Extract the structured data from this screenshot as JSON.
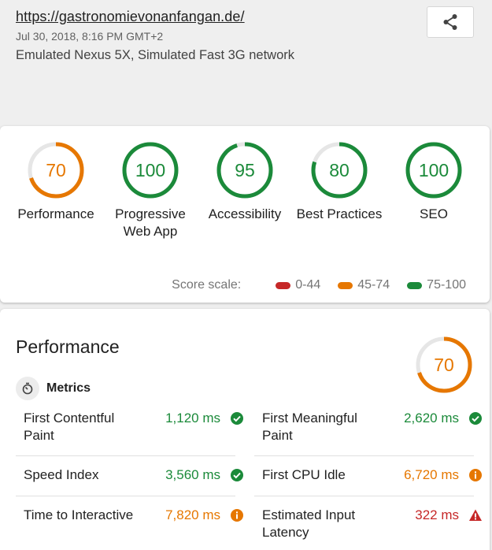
{
  "report": {
    "url": "https://gastronomievonanfangan.de/",
    "date": "Jul 30, 2018, 8:16 PM GMT+2",
    "device": "Emulated Nexus 5X, Simulated Fast 3G network"
  },
  "colors": {
    "fail": "#c62828",
    "average": "#e67700",
    "pass": "#1b8a3a"
  },
  "categories": [
    {
      "score": "70",
      "label": "Performance",
      "rating": "average"
    },
    {
      "score": "100",
      "label": "Progressive Web App",
      "rating": "pass"
    },
    {
      "score": "95",
      "label": "Accessibility",
      "rating": "pass"
    },
    {
      "score": "80",
      "label": "Best Practices",
      "rating": "pass"
    },
    {
      "score": "100",
      "label": "SEO",
      "rating": "pass"
    }
  ],
  "scale": {
    "title": "Score scale:",
    "ranges": [
      {
        "label": "0-44",
        "rating": "fail"
      },
      {
        "label": "45-74",
        "rating": "average"
      },
      {
        "label": "75-100",
        "rating": "pass"
      }
    ]
  },
  "performance": {
    "title": "Performance",
    "score": "70",
    "metrics_title": "Metrics",
    "metrics": [
      {
        "name": "First Contentful Paint",
        "value": "1,120 ms",
        "rating": "pass"
      },
      {
        "name": "First Meaningful Paint",
        "value": "2,620 ms",
        "rating": "pass"
      },
      {
        "name": "Speed Index",
        "value": "3,560 ms",
        "rating": "pass"
      },
      {
        "name": "First CPU Idle",
        "value": "6,720 ms",
        "rating": "average"
      },
      {
        "name": "Time to Interactive",
        "value": "7,820 ms",
        "rating": "average"
      },
      {
        "name": "Estimated Input Latency",
        "value": "322 ms",
        "rating": "fail"
      }
    ]
  }
}
